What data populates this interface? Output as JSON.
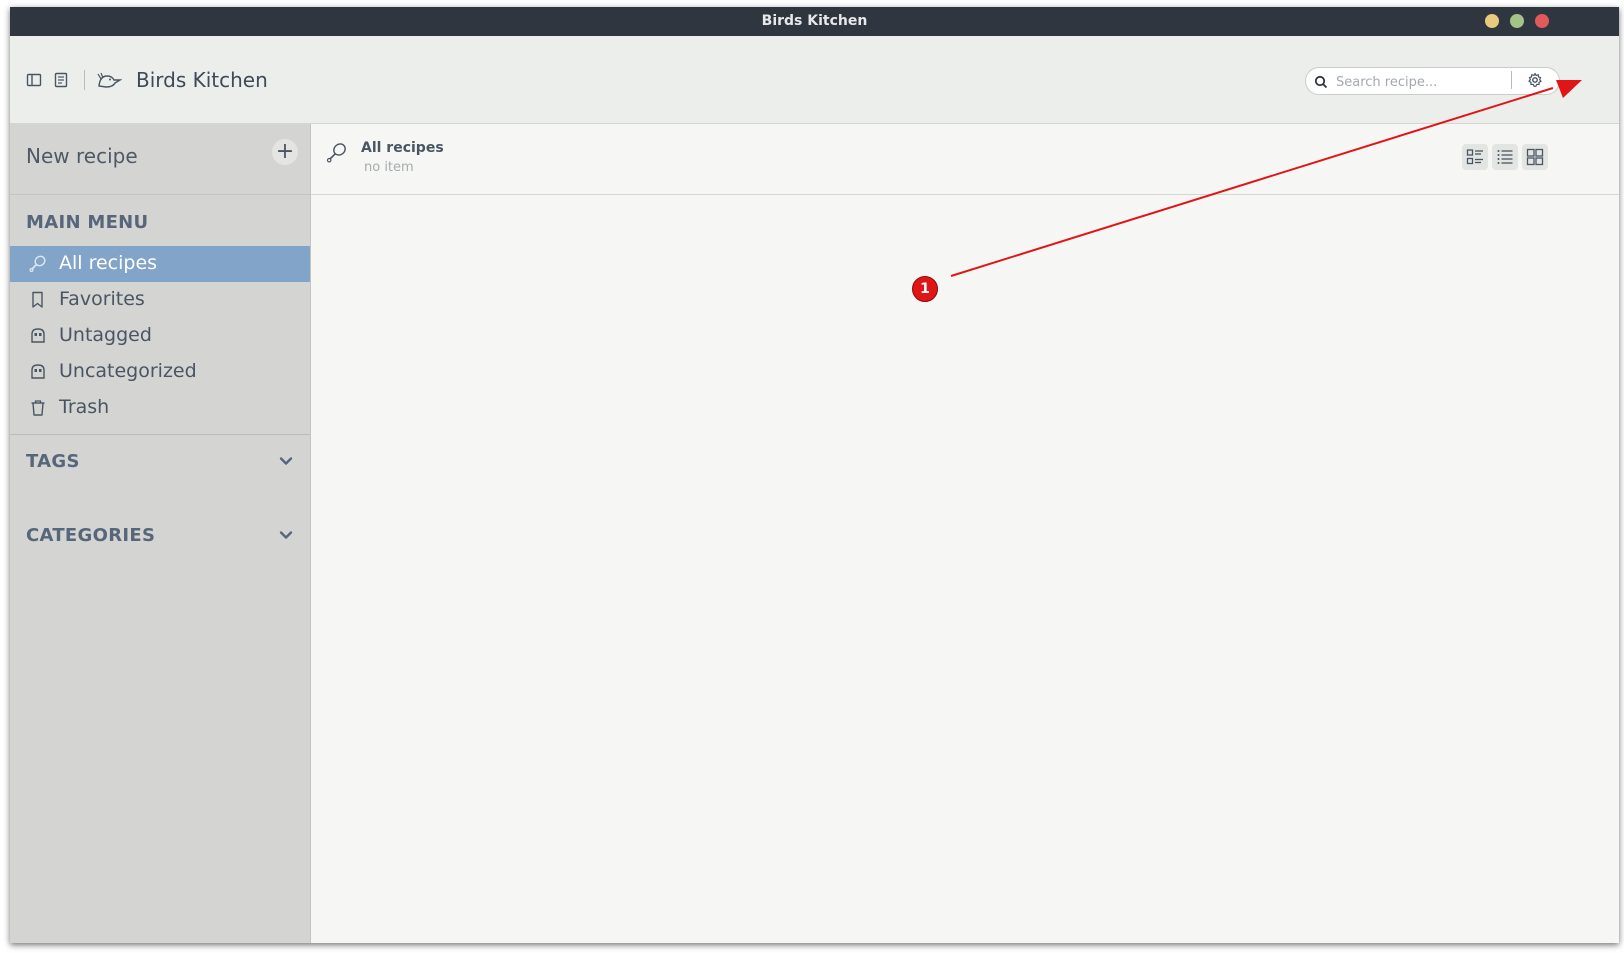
{
  "window": {
    "title": "Birds Kitchen",
    "buttons": {
      "minimize_color": "#e8c97e",
      "maximize_color": "#a5c386",
      "close_color": "#e05a5a"
    }
  },
  "header": {
    "app_title": "Birds Kitchen",
    "search_placeholder": "Search recipe...",
    "search_value": ""
  },
  "sidebar": {
    "new_recipe_label": "New recipe",
    "main_menu_title": "MAIN MENU",
    "items": [
      {
        "label": "All recipes",
        "icon": "drumstick-icon",
        "active": true
      },
      {
        "label": "Favorites",
        "icon": "bookmark-icon",
        "active": false
      },
      {
        "label": "Untagged",
        "icon": "tag-icon",
        "active": false
      },
      {
        "label": "Uncategorized",
        "icon": "category-icon",
        "active": false
      },
      {
        "label": "Trash",
        "icon": "trash-icon",
        "active": false
      }
    ],
    "tags_title": "TAGS",
    "categories_title": "CATEGORIES"
  },
  "content": {
    "title": "All recipes",
    "count_text": "no item",
    "view_modes": [
      "list-detail-view",
      "list-view",
      "grid-view"
    ]
  },
  "annotation": {
    "badge_number": "1",
    "color": "#e01616"
  },
  "colors": {
    "titlebar": "#2f3640",
    "sidebar": "#d4d5d3",
    "active_item": "#82a4c9",
    "content_bg": "#f6f7f5"
  }
}
